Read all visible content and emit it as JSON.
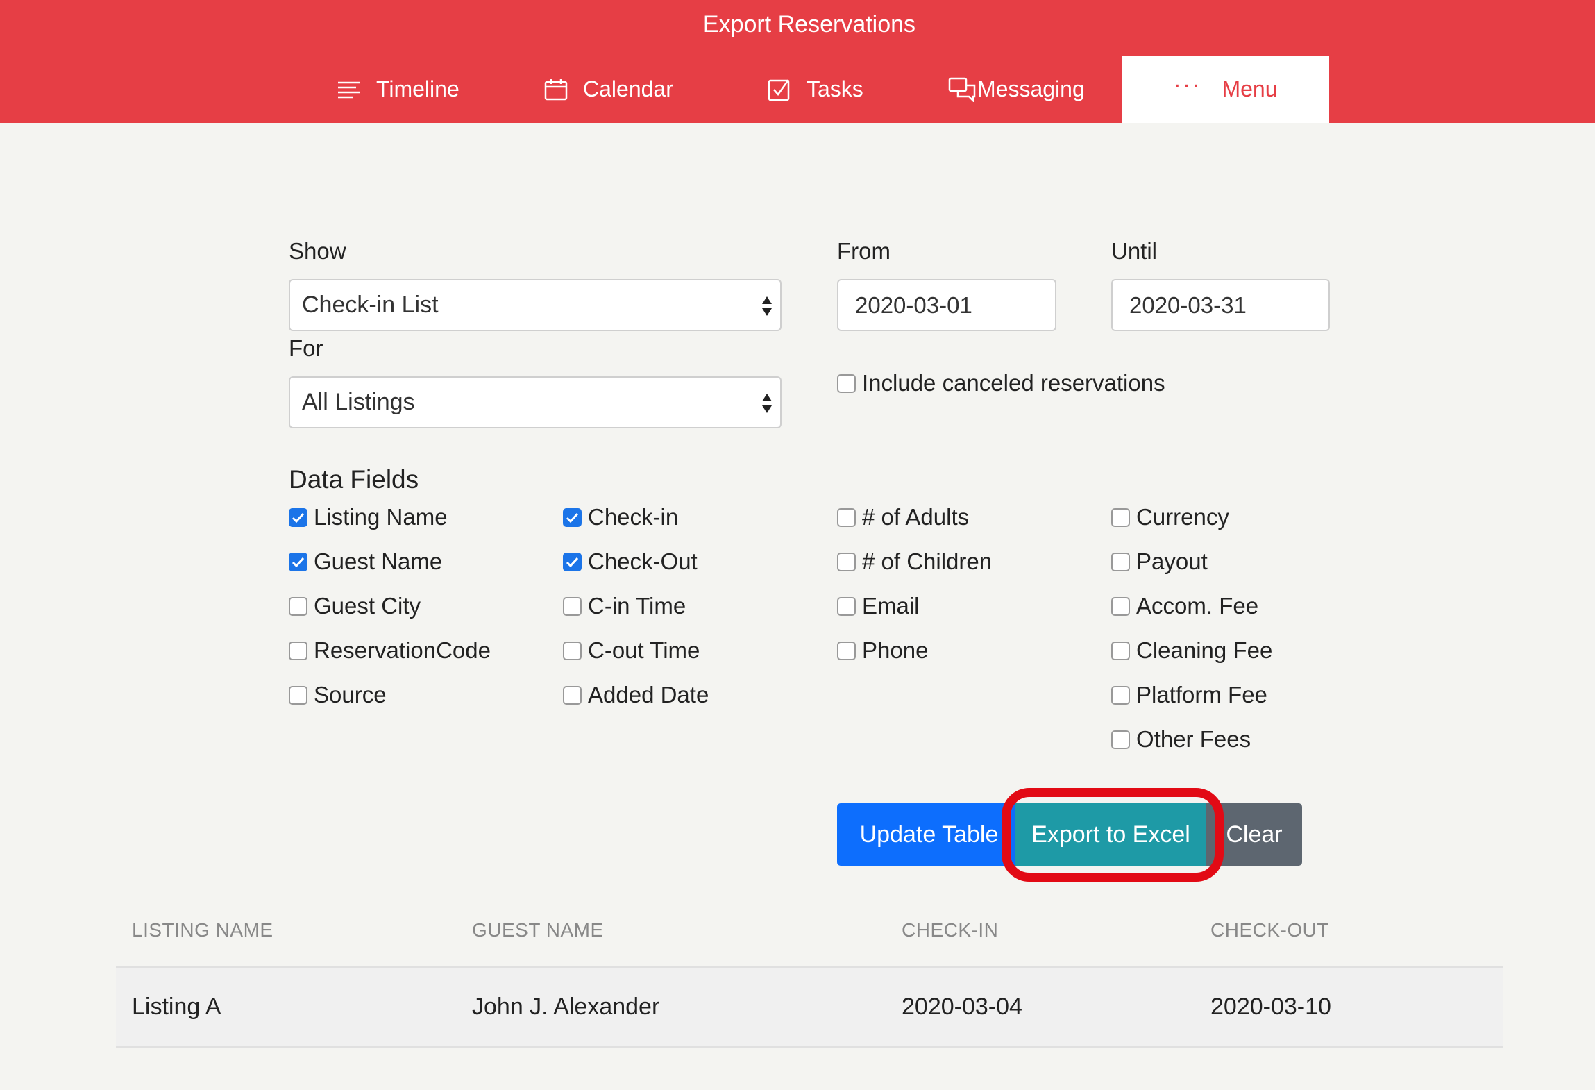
{
  "header": {
    "title": "Export Reservations",
    "nav": [
      {
        "label": "Timeline",
        "icon": "list-lines-icon"
      },
      {
        "label": "Calendar",
        "icon": "calendar-icon"
      },
      {
        "label": "Tasks",
        "icon": "task-checkbox-icon"
      },
      {
        "label": "Messaging",
        "icon": "chat-bubbles-icon"
      },
      {
        "label": "Menu",
        "icon": "more-dots-icon",
        "dots": "···"
      }
    ]
  },
  "filters": {
    "show_label": "Show",
    "show_value": "Check-in List",
    "for_label": "For",
    "for_value": "All Listings",
    "from_label": "From",
    "from_value": "2020-03-01",
    "until_label": "Until",
    "until_value": "2020-03-31",
    "include_canceled_label": "Include canceled reservations"
  },
  "data_fields": {
    "title": "Data Fields",
    "col1": [
      {
        "label": "Listing Name",
        "checked": true
      },
      {
        "label": "Guest Name",
        "checked": true
      },
      {
        "label": "Guest City",
        "checked": false
      },
      {
        "label": "ReservationCode",
        "checked": false
      },
      {
        "label": "Source",
        "checked": false
      }
    ],
    "col2": [
      {
        "label": "Check-in",
        "checked": true
      },
      {
        "label": "Check-Out",
        "checked": true
      },
      {
        "label": "C-in Time",
        "checked": false
      },
      {
        "label": "C-out Time",
        "checked": false
      },
      {
        "label": "Added Date",
        "checked": false
      }
    ],
    "col3": [
      {
        "label": "# of Adults",
        "checked": false
      },
      {
        "label": "# of Children",
        "checked": false
      },
      {
        "label": "Email",
        "checked": false
      },
      {
        "label": "Phone",
        "checked": false
      }
    ],
    "col4": [
      {
        "label": "Currency",
        "checked": false
      },
      {
        "label": "Payout",
        "checked": false
      },
      {
        "label": "Accom. Fee",
        "checked": false
      },
      {
        "label": "Cleaning Fee",
        "checked": false
      },
      {
        "label": "Platform Fee",
        "checked": false
      },
      {
        "label": "Other Fees",
        "checked": false
      }
    ]
  },
  "actions": {
    "update_label": "Update Table",
    "export_label": "Export to Excel",
    "clear_label": "Clear"
  },
  "table": {
    "headers": [
      "LISTING NAME",
      "GUEST NAME",
      "CHECK-IN",
      "CHECK-OUT"
    ],
    "rows": [
      [
        "Listing A",
        "John J. Alexander",
        "2020-03-04",
        "2020-03-10"
      ]
    ]
  },
  "colors": {
    "header_bg": "#e63e45",
    "update_btn": "#0d6efd",
    "export_btn": "#1e9aa6",
    "clear_btn": "#5d6670",
    "highlight": "#e20a15"
  }
}
